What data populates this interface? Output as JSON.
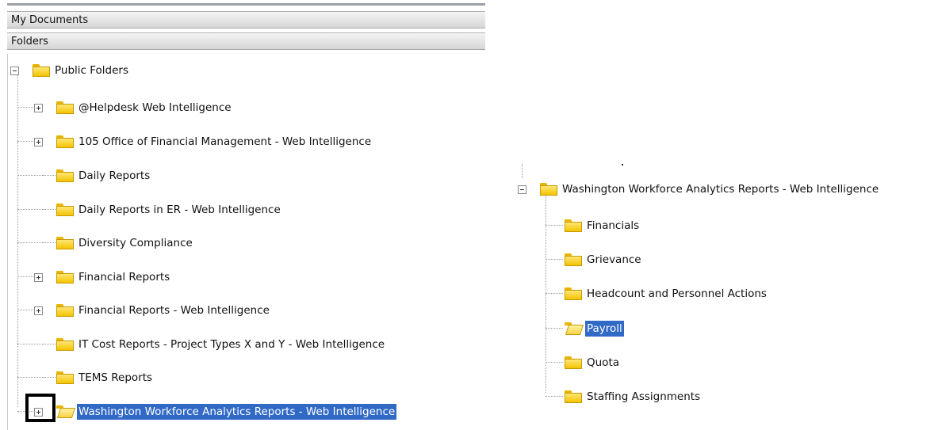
{
  "left_panel": {
    "headers": [
      "My Documents",
      "Folders"
    ],
    "root": {
      "label": "Public Folders",
      "toggle": "minus"
    },
    "items": [
      {
        "label": "@Helpdesk Web Intelligence",
        "toggle": "plus"
      },
      {
        "label": "105 Office of Financial Management - Web Intelligence",
        "toggle": "plus"
      },
      {
        "label": "Daily Reports",
        "toggle": "none"
      },
      {
        "label": "Daily Reports in ER - Web Intelligence",
        "toggle": "none"
      },
      {
        "label": "Diversity Compliance",
        "toggle": "none"
      },
      {
        "label": "Financial Reports",
        "toggle": "plus"
      },
      {
        "label": "Financial Reports - Web Intelligence",
        "toggle": "plus"
      },
      {
        "label": "IT Cost Reports - Project Types X and Y - Web Intelligence",
        "toggle": "none"
      },
      {
        "label": "TEMS Reports",
        "toggle": "none"
      },
      {
        "label": "Washington Workforce Analytics Reports - Web Intelligence",
        "toggle": "plus",
        "selected": true,
        "open": true,
        "highlighted": true
      }
    ]
  },
  "right_panel": {
    "root": {
      "label": "Washington Workforce Analytics Reports - Web Intelligence",
      "toggle": "minus"
    },
    "items": [
      {
        "label": "Financials"
      },
      {
        "label": "Grievance"
      },
      {
        "label": "Headcount and Personnel Actions"
      },
      {
        "label": "Payroll",
        "selected": true,
        "open": true
      },
      {
        "label": "Quota"
      },
      {
        "label": "Staffing Assignments"
      }
    ]
  },
  "colors": {
    "selection": "#3169c6",
    "folder": "#f3c400",
    "header": "#dcdcdc"
  },
  "icons": {
    "folder": "folder-icon",
    "open_folder": "folder-open-icon",
    "expand": "expand-icon",
    "collapse": "collapse-icon"
  }
}
